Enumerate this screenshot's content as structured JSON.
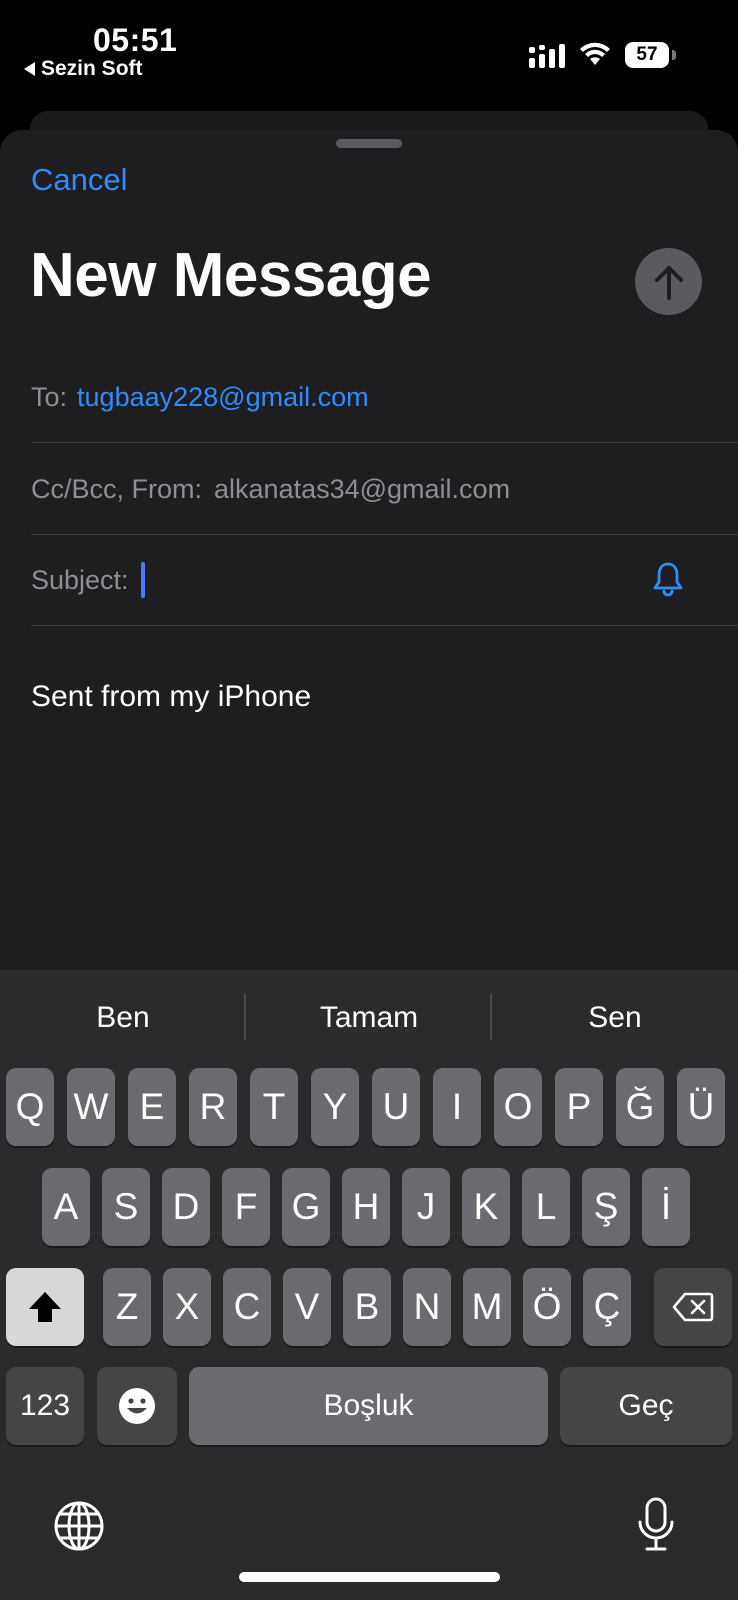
{
  "status_bar": {
    "time": "05:51",
    "back_app": "Sezin Soft",
    "battery": "57"
  },
  "compose": {
    "cancel_label": "Cancel",
    "title": "New Message",
    "to_label": "To:",
    "to_value": "tugbaay228@gmail.com",
    "cc_label": "Cc/Bcc, From:",
    "cc_value": "alkanatas34@gmail.com",
    "subject_label": "Subject:",
    "subject_value": "",
    "body": "Sent from my iPhone"
  },
  "keyboard": {
    "suggestions": [
      "Ben",
      "Tamam",
      "Sen"
    ],
    "row1": [
      "Q",
      "W",
      "E",
      "R",
      "T",
      "Y",
      "U",
      "I",
      "O",
      "P",
      "Ğ",
      "Ü"
    ],
    "row2": [
      "A",
      "S",
      "D",
      "F",
      "G",
      "H",
      "J",
      "K",
      "L",
      "Ş",
      "İ"
    ],
    "row3": [
      "Z",
      "X",
      "C",
      "V",
      "B",
      "N",
      "M",
      "Ö",
      "Ç"
    ],
    "numbers_label": "123",
    "space_label": "Boşluk",
    "return_label": "Geç"
  },
  "colors": {
    "accent": "#2f8cff",
    "background": "#1e1e20",
    "keyboard_bg": "#2b2b2d",
    "key_bg": "#6b6b6f"
  }
}
